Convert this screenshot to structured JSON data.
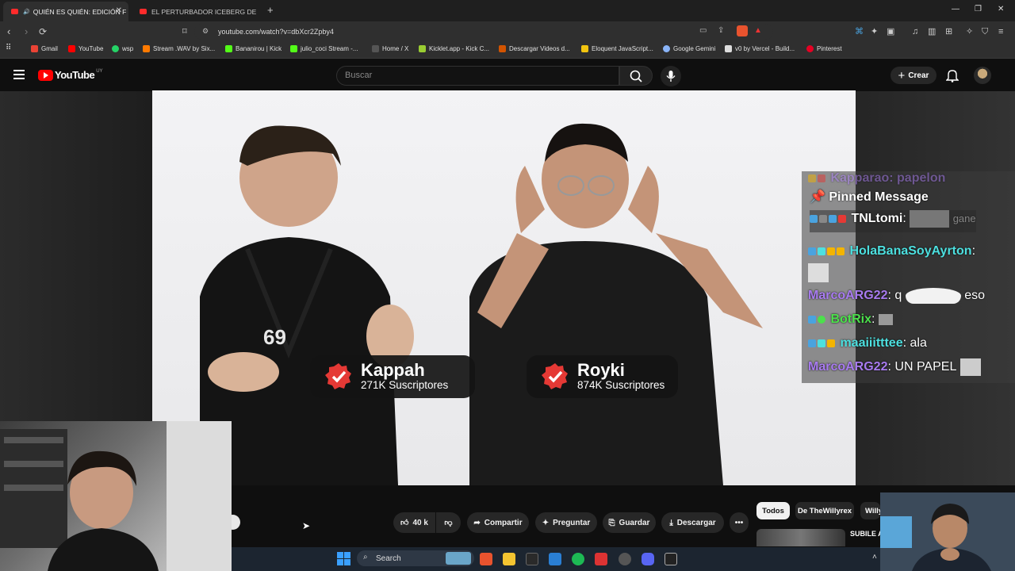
{
  "tabs": [
    {
      "label": "QUIÉN ES QUIÉN: EDICIÓN F",
      "active": true
    },
    {
      "label": "EL PERTURBADOR ICEBERG DE LOS J",
      "active": false
    }
  ],
  "new_tab": "+",
  "address": {
    "url": "youtube.com/watch?v=dbXcr2Zpby4"
  },
  "bookmarks": [
    {
      "label": "Gmail",
      "color": "#ea4335"
    },
    {
      "label": "YouTube",
      "color": "#ff0000"
    },
    {
      "label": "wsp",
      "color": "#25d366"
    },
    {
      "label": "Stream .WAV by Six...",
      "color": "#ff7a00"
    },
    {
      "label": "Bananirou | Kick",
      "color": "#53fc18"
    },
    {
      "label": "julio_coci Stream -...",
      "color": "#53fc18"
    },
    {
      "label": "Home / X",
      "color": "#888888"
    },
    {
      "label": "Kicklet.app - Kick C...",
      "color": "#9acd32"
    },
    {
      "label": "Descargar Videos d...",
      "color": "#d35400"
    },
    {
      "label": "Eloquent JavaScript...",
      "color": "#f1c40f"
    },
    {
      "label": "Google Gemini",
      "color": "#8ab4f8"
    },
    {
      "label": "v0 by Vercel - Build...",
      "color": "#dddddd"
    },
    {
      "label": "Pinterest",
      "color": "#e60023"
    }
  ],
  "youtube": {
    "logo_text": "YouTube",
    "region": "UY",
    "search_placeholder": "Buscar",
    "create_label": "Crear"
  },
  "video": {
    "badges": [
      {
        "name": "Kappah",
        "subs": "271K Suscriptores"
      },
      {
        "name": "Royki",
        "subs": "874K Suscriptores"
      }
    ]
  },
  "chat": {
    "top_partial": "Kapparao: papelon",
    "pinned_label": "Pinned Message",
    "pinned_user": "TNLtomi",
    "pinned_partial": "gane",
    "lines": [
      {
        "user": "HolaBanaSoyAyrton",
        "sep": ":",
        "message": ""
      },
      {
        "user": "MarcoARG22",
        "sep": ":",
        "message": "q",
        "message2": "eso"
      },
      {
        "user": "BotRix",
        "sep": ":",
        "message": ""
      },
      {
        "user": "maaiiitttee",
        "sep": ":",
        "message": "ala"
      },
      {
        "user": "MarcoARG22",
        "sep": ":",
        "message": "UN PAPEL"
      }
    ]
  },
  "actions": {
    "likes": "40 k",
    "share": "Compartir",
    "ask": "Preguntar",
    "save": "Guardar",
    "download": "Descargar"
  },
  "chips": [
    "Todos",
    "De TheWillyrex",
    "Willy"
  ],
  "recommendation_partial": "SUBILE A",
  "taskbar": {
    "search": "Search"
  }
}
